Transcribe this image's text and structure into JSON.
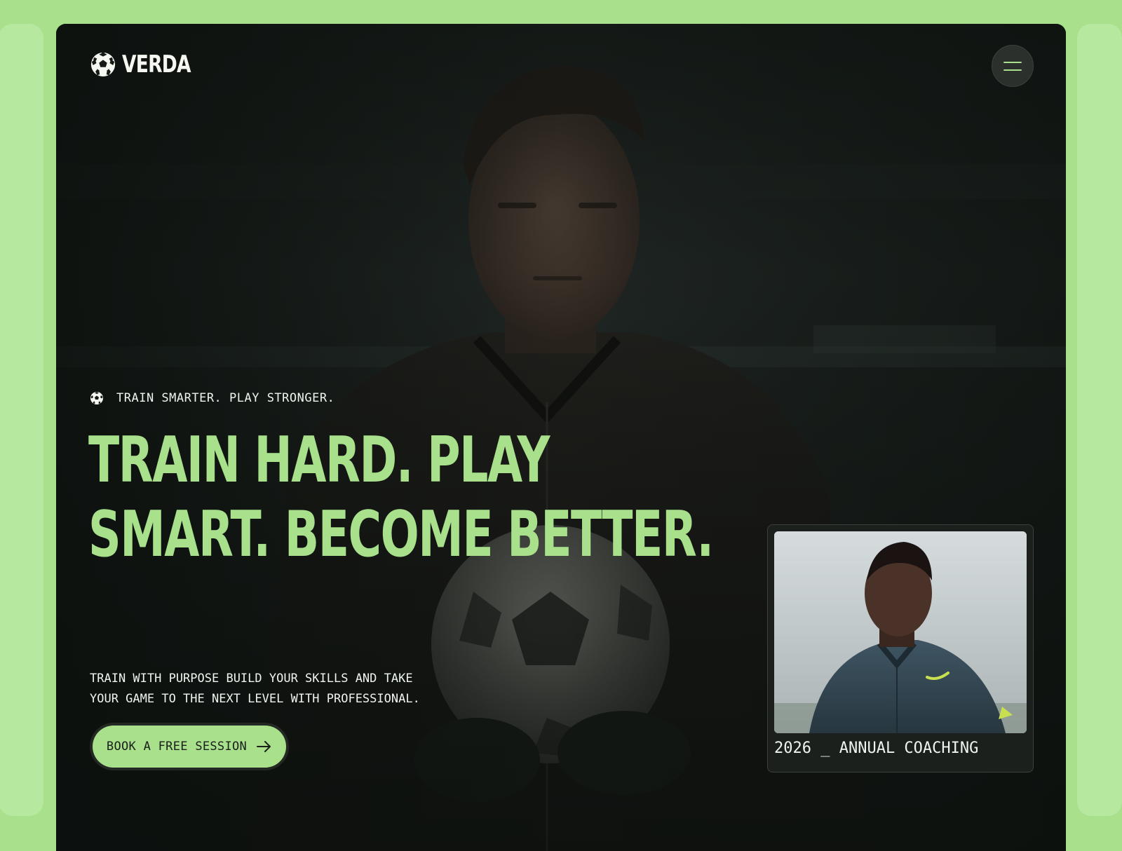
{
  "brand": {
    "name": "VERDA",
    "logo_icon": "soccer-ball-icon"
  },
  "nav": {
    "menu_icon": "hamburger-menu-icon"
  },
  "hero": {
    "tagline": "TRAIN SMARTER. PLAY STRONGER.",
    "tagline_icon": "soccer-ball-icon",
    "headline_line1": "TRAIN HARD. PLAY",
    "headline_line2": "SMART. BECOME BETTER.",
    "description_line1": "TRAIN WITH PURPOSE BUILD YOUR SKILLS AND TAKE",
    "description_line2": "YOUR GAME TO THE NEXT LEVEL WITH PROFESSIONAL.",
    "cta_label": "BOOK A FREE SESSION",
    "cta_icon": "arrow-right-icon"
  },
  "coach_card": {
    "caption": "2026 _ ANNUAL COACHING"
  },
  "colors": {
    "accent": "#a8e08c",
    "background": "#151a16",
    "text": "#f0f4ee"
  }
}
